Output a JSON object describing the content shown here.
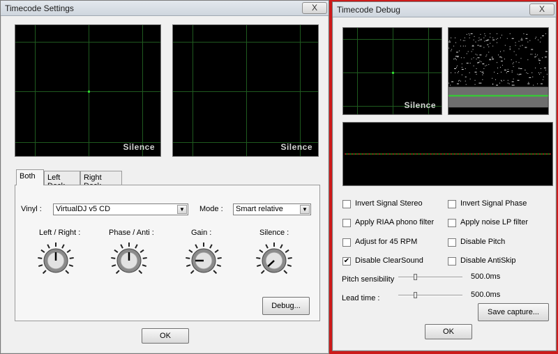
{
  "settings_window": {
    "title": "Timecode Settings",
    "close_label": "X",
    "left_scope_label": "Silence",
    "right_scope_label": "Silence",
    "tabs": [
      "Both",
      "Left Deck",
      "Right Deck"
    ],
    "vinyl_label": "Vinyl :",
    "vinyl_value": "VirtualDJ v5 CD",
    "mode_label": "Mode :",
    "mode_value": "Smart relative",
    "knobs": [
      {
        "label": "Left / Right :",
        "level": 0.0
      },
      {
        "label": "Phase / Anti :",
        "level": 0.0
      },
      {
        "label": "Gain :",
        "level": -0.25
      },
      {
        "label": "Silence :",
        "level": -0.37
      }
    ],
    "debug_label": "Debug...",
    "ok_label": "OK"
  },
  "debug_window": {
    "title": "Timecode Debug",
    "close_label": "X",
    "scope_label": "Silence",
    "options": [
      {
        "label": "Invert Signal Stereo",
        "checked": false
      },
      {
        "label": "Invert Signal Phase",
        "checked": false
      },
      {
        "label": "Apply RIAA phono filter",
        "checked": false
      },
      {
        "label": "Apply noise LP filter",
        "checked": false
      },
      {
        "label": "Adjust for 45 RPM",
        "checked": false
      },
      {
        "label": "Disable Pitch",
        "checked": false
      },
      {
        "label": "Disable ClearSound",
        "checked": true
      },
      {
        "label": "Disable AntiSkip",
        "checked": false
      }
    ],
    "check_mark": "✔",
    "pitch_label": "Pitch sensibility",
    "pitch_value": "500.0ms",
    "pitch_level": 0.25,
    "lead_label": "Lead time :",
    "lead_value": "500.0ms",
    "lead_level": 0.25,
    "save_label": "Save capture...",
    "ok_label": "OK"
  },
  "colors": {
    "scope_bg": "#000000",
    "grid_green": "#1f5a1f",
    "signal_green": "#2ed82e",
    "signal_red": "#d02020",
    "desktop_red": "#cc1a1a"
  }
}
